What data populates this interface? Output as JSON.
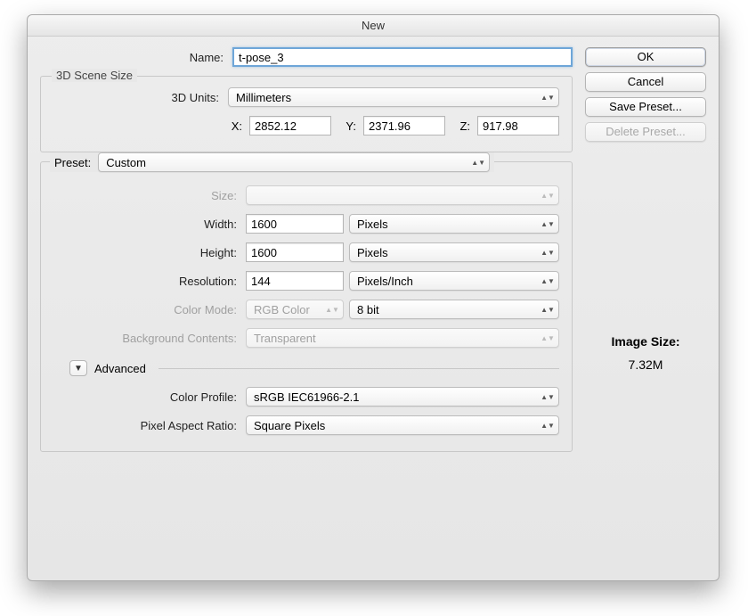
{
  "window": {
    "title": "New"
  },
  "name": {
    "label": "Name:",
    "value": "t-pose_3"
  },
  "sceneSize": {
    "legend": "3D Scene Size",
    "unitsLabel": "3D Units:",
    "unitsValue": "Millimeters",
    "xLabel": "X:",
    "xValue": "2852.12",
    "yLabel": "Y:",
    "yValue": "2371.96",
    "zLabel": "Z:",
    "zValue": "917.98"
  },
  "preset": {
    "label": "Preset:",
    "value": "Custom",
    "sizeLabel": "Size:",
    "sizeValue": "",
    "widthLabel": "Width:",
    "widthValue": "1600",
    "widthUnits": "Pixels",
    "heightLabel": "Height:",
    "heightValue": "1600",
    "heightUnits": "Pixels",
    "resolutionLabel": "Resolution:",
    "resolutionValue": "144",
    "resolutionUnits": "Pixels/Inch",
    "colorModeLabel": "Color Mode:",
    "colorModeValue": "RGB Color",
    "colorDepthValue": "8 bit",
    "bgLabel": "Background Contents:",
    "bgValue": "Transparent"
  },
  "advanced": {
    "label": "Advanced",
    "colorProfileLabel": "Color Profile:",
    "colorProfileValue": "sRGB IEC61966-2.1",
    "pixelAspectLabel": "Pixel Aspect Ratio:",
    "pixelAspectValue": "Square Pixels"
  },
  "buttons": {
    "ok": "OK",
    "cancel": "Cancel",
    "savePreset": "Save Preset...",
    "deletePreset": "Delete Preset..."
  },
  "imageSize": {
    "label": "Image Size:",
    "value": "7.32M"
  }
}
